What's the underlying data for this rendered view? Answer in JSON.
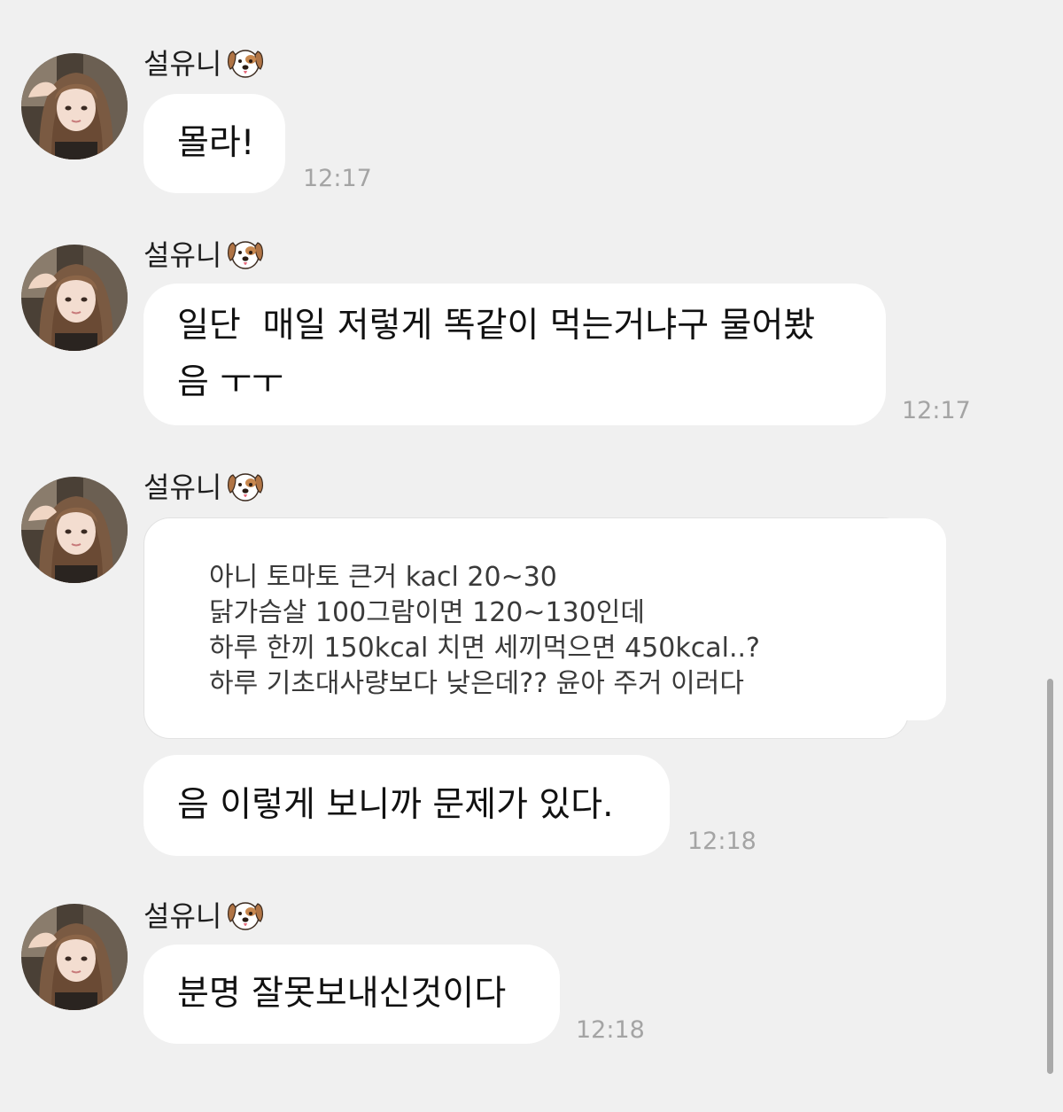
{
  "messages": [
    {
      "sender": "설유니",
      "text": "몰라!",
      "time": "12:17"
    },
    {
      "sender": "설유니",
      "text": "일단  매일 저렇게 똑같이 먹는거냐구 물어봤\n음 ㅜㅜ",
      "time": "12:17"
    },
    {
      "sender": "설유니",
      "card_lines": [
        "아니 토마토 큰거 kacl 20~30",
        "닭가슴살 100그람이면 120~130인데",
        "하루 한끼 150kcal 치면 세끼먹으면 450kcal..?",
        "하루 기초대사량보다 낮은데?? 윤아 주거 이러다"
      ]
    },
    {
      "text": "음 이렇게 보니까 문제가 있다.",
      "time": "12:18"
    },
    {
      "sender": "설유니",
      "text": "분명 잘못보내신것이다",
      "time": "12:18"
    }
  ],
  "icons": {
    "sender_badge": "dog-face-icon",
    "avatar": "profile-photo"
  },
  "colors": {
    "background": "#f0f0f0",
    "bubble": "#ffffff",
    "timestamp": "#a4a4a4"
  }
}
